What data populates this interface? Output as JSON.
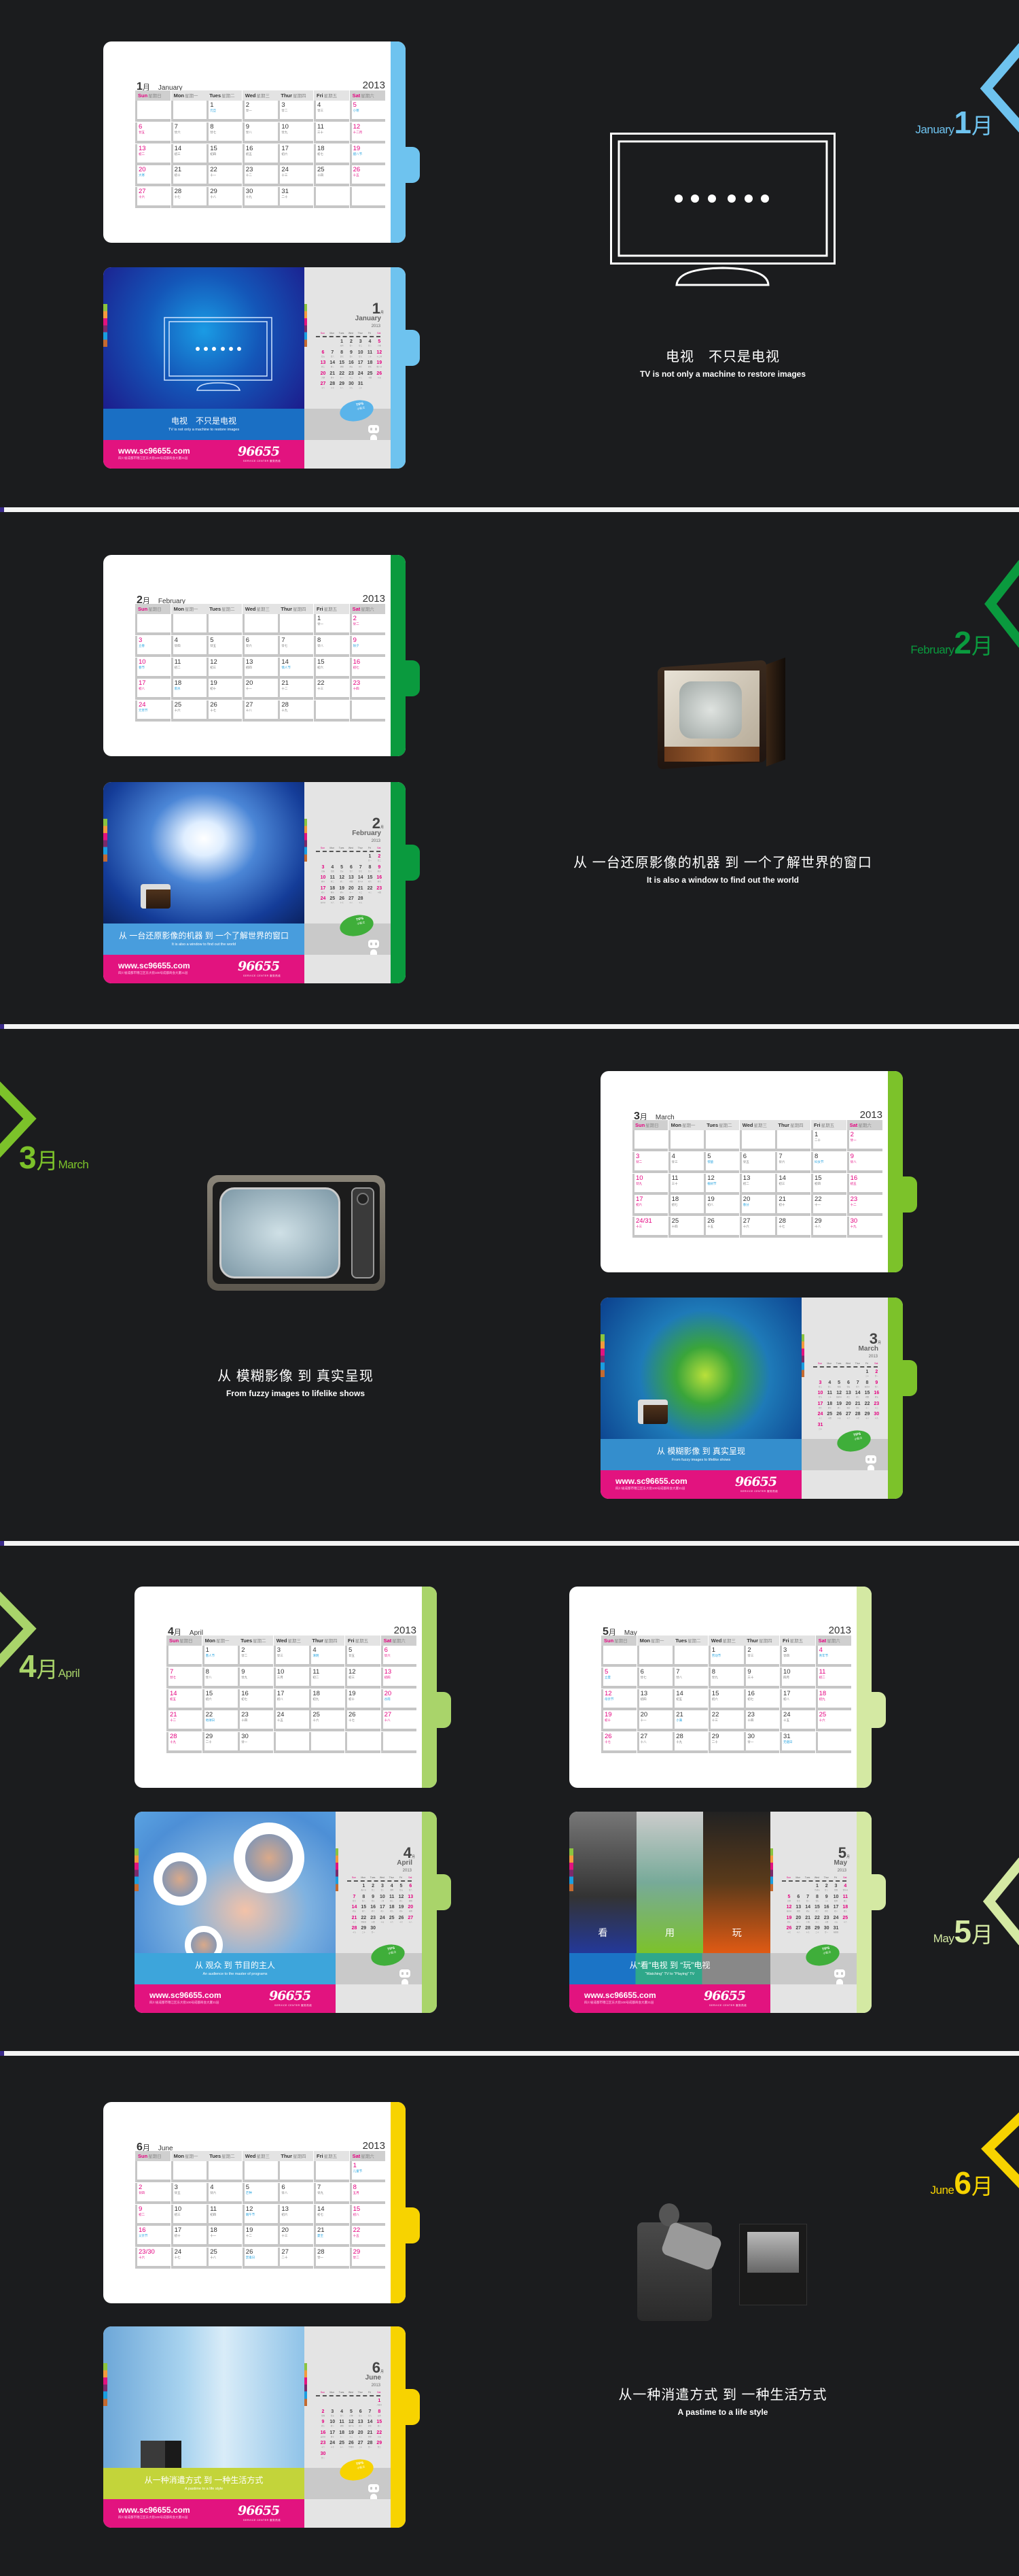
{
  "year": "2013",
  "month_suffix": "月",
  "weekdays_en": [
    "Sun",
    "Mon",
    "Tues",
    "Wed",
    "Thur",
    "Fri",
    "Sat"
  ],
  "weekdays_cn": [
    "星期日",
    "星期一",
    "星期二",
    "星期三",
    "星期四",
    "星期五",
    "星期六"
  ],
  "footer": {
    "url": "www.sc96655.com",
    "address": "四川省成都市锦江区东大街100号成都商会大厦21层",
    "logo": "96655",
    "logo_sub": "SERVICE CENTER 服务热线"
  },
  "tips": {
    "label": "TIPS",
    "sub": "小贴士"
  },
  "months": [
    {
      "num": "1",
      "name": "January",
      "accent": "#6ec3ef",
      "first_weekday": 2,
      "caption_cn": "电视　不只是电视",
      "caption_en": "TV is not only a machine to restore images",
      "festivals": [
        1,
        5,
        19,
        20
      ],
      "lunar": [
        "元旦",
        "廿一",
        "廿二",
        "廿三",
        "小寒",
        "廿五",
        "廿六",
        "廿七",
        "廿八",
        "廿九",
        "三十",
        "十二月",
        "初二",
        "初三",
        "初四",
        "初五",
        "初六",
        "初七",
        "腊八节",
        "大寒",
        "初十",
        "十一",
        "十二",
        "十三",
        "十四",
        "十五",
        "十六",
        "十七",
        "十八",
        "十九",
        "二十"
      ]
    },
    {
      "num": "2",
      "name": "February",
      "accent": "#0a9a3e",
      "first_weekday": 5,
      "caption_cn": "从 一台还原影像的机器 到 一个了解世界的窗口",
      "caption_en": "It is also a window to find out the world",
      "festivals": [
        3,
        9,
        10,
        14,
        18,
        24
      ],
      "lunar": [
        "廿一",
        "廿二",
        "立春",
        "廿四",
        "廿五",
        "廿六",
        "廿七",
        "廿八",
        "除夕",
        "春节",
        "初二",
        "初三",
        "初四",
        "情人节",
        "初六",
        "初七",
        "初八",
        "雨水",
        "初十",
        "十一",
        "十二",
        "十三",
        "十四",
        "元宵节",
        "十六",
        "十七",
        "十八",
        "十九"
      ]
    },
    {
      "num": "3",
      "name": "March",
      "accent": "#7cc22a",
      "first_weekday": 5,
      "caption_cn": "从 模糊影像 到 真实呈现",
      "caption_en": "From fuzzy images to lifelike shows",
      "festivals": [
        5,
        8,
        12,
        20
      ],
      "lunar": [
        "二十",
        "廿一",
        "廿二",
        "廿三",
        "惊蛰",
        "廿五",
        "廿六",
        "妇女节",
        "廿八",
        "廿九",
        "三十",
        "植树节",
        "初二",
        "初三",
        "初四",
        "初五",
        "初六",
        "初七",
        "初八",
        "春分",
        "初十",
        "十一",
        "十二",
        "十三",
        "十四",
        "十五",
        "十六",
        "十七",
        "十八",
        "十九",
        "二十"
      ]
    },
    {
      "num": "4",
      "name": "April",
      "accent": "#a9d46a",
      "first_weekday": 1,
      "caption_cn": "从 观众 到 节目的主人",
      "caption_en": "An audience to the master of programs",
      "festivals": [
        1,
        4,
        20,
        22
      ],
      "lunar": [
        "愚人节",
        "廿二",
        "廿三",
        "清明",
        "廿五",
        "廿六",
        "廿七",
        "廿八",
        "廿九",
        "三月",
        "初二",
        "初三",
        "初四",
        "初五",
        "初六",
        "初七",
        "初八",
        "初九",
        "初十",
        "谷雨",
        "十二",
        "地球日",
        "十四",
        "十五",
        "十六",
        "十七",
        "十八",
        "十九",
        "二十",
        "廿一"
      ]
    },
    {
      "num": "5",
      "name": "May",
      "accent": "#d4e9a3",
      "first_weekday": 3,
      "caption_cn": "从“看”电视 到 “玩”电视",
      "caption_en": "“Watching” TV to “Playing” TV",
      "panels": [
        "看",
        "用",
        "玩"
      ],
      "festivals": [
        1,
        4,
        5,
        12,
        21,
        31
      ],
      "lunar": [
        "劳动节",
        "廿三",
        "廿四",
        "青年节",
        "立夏",
        "廿七",
        "廿八",
        "廿九",
        "三十",
        "四月",
        "初二",
        "母亲节",
        "初四",
        "初五",
        "初六",
        "初七",
        "初八",
        "初九",
        "初十",
        "十一",
        "小满",
        "十三",
        "十四",
        "十五",
        "十六",
        "十七",
        "十八",
        "十九",
        "二十",
        "廿一",
        "无烟日"
      ]
    },
    {
      "num": "6",
      "name": "June",
      "accent": "#f7d300",
      "first_weekday": 6,
      "caption_cn": "从一种消遣方式 到 一种生活方式",
      "caption_en": "A pastime to a life style",
      "festivals": [
        1,
        5,
        12,
        16,
        21,
        26
      ],
      "lunar": [
        "儿童节",
        "廿四",
        "廿五",
        "廿六",
        "芒种",
        "廿八",
        "廿九",
        "五月",
        "初二",
        "初三",
        "初四",
        "端午节",
        "初六",
        "初七",
        "初八",
        "父亲节",
        "初十",
        "十一",
        "十二",
        "十三",
        "夏至",
        "十五",
        "十六",
        "十七",
        "十八",
        "禁毒日",
        "二十",
        "廿一",
        "廿二",
        "廿三"
      ]
    }
  ]
}
